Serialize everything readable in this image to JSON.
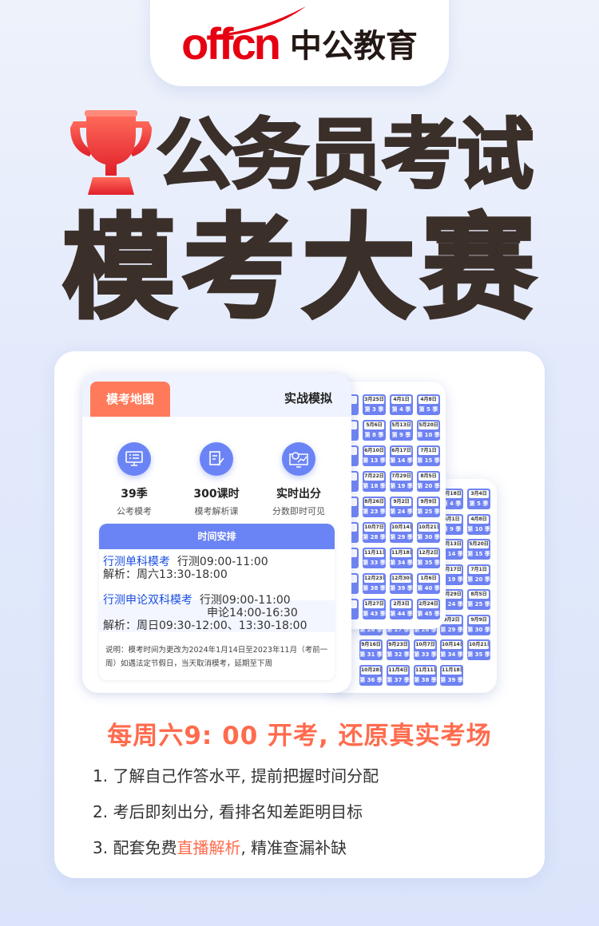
{
  "logo": {
    "en": "offcn",
    "cn": "中公教育"
  },
  "title": {
    "line1": "公务员考试",
    "line2": "模考大赛",
    "icon": "trophy-icon"
  },
  "map_card": {
    "tab": "模考地图",
    "right": "实战模拟",
    "features": [
      {
        "icon": "monitor-checklist-icon",
        "title": "39季",
        "subtitle": "公考模考"
      },
      {
        "icon": "document-pen-icon",
        "title": "300课时",
        "subtitle": "模考解析课"
      },
      {
        "icon": "live-score-icon",
        "title": "实时出分",
        "subtitle": "分数即时可见"
      }
    ],
    "schedule": {
      "header": "时间安排",
      "single": {
        "name": "行测单科模考",
        "time": "行测09:00-11:00",
        "analysis": "解析：周六13:30-18:00"
      },
      "double": {
        "name": "行测申论双科模考",
        "time1": "行测09:00-11:00",
        "time2": "申论14:00-16:30",
        "analysis": "解析：周日09:30-12:00、13:30-18:00"
      },
      "note": "说明：模考时间为更改为2024年1月14日至2023年11月（考前一周）如遇法定节假日，当天取消模考，延期至下周"
    }
  },
  "calendar_front": [
    [
      {
        "date": "3月25日",
        "season": "第 3 季"
      },
      {
        "date": "4月1日",
        "season": "第 4 季"
      },
      {
        "date": "4月8日",
        "season": "第 5 季"
      }
    ],
    [
      {
        "date": "5月6日",
        "season": "第 8 季"
      },
      {
        "date": "5月13日",
        "season": "第 9 季"
      },
      {
        "date": "5月20日",
        "season": "第 10 季"
      }
    ],
    [
      {
        "date": "6月10日",
        "season": "第 13 季"
      },
      {
        "date": "6月17日",
        "season": "第 14 季"
      },
      {
        "date": "7月1日",
        "season": "第 15 季"
      }
    ],
    [
      {
        "date": "7月22日",
        "season": "第 18 季"
      },
      {
        "date": "7月29日",
        "season": "第 19 季"
      },
      {
        "date": "8月5日",
        "season": "第 20 季"
      }
    ],
    [
      {
        "date": "8月26日",
        "season": "第 23 季"
      },
      {
        "date": "9月2日",
        "season": "第 24 季"
      },
      {
        "date": "9月9日",
        "season": "第 25 季"
      }
    ],
    [
      {
        "date": "10月7日",
        "season": "第 28 季"
      },
      {
        "date": "10月14日",
        "season": "第 29 季"
      },
      {
        "date": "10月21日",
        "season": "第 30 季"
      }
    ],
    [
      {
        "date": "11月11日",
        "season": "第 33 季"
      },
      {
        "date": "11月18日",
        "season": "第 34 季"
      },
      {
        "date": "12月2日",
        "season": "第 35 季"
      }
    ],
    [
      {
        "date": "12月23日",
        "season": "第 38 季"
      },
      {
        "date": "12月30日",
        "season": "第 39 季"
      },
      {
        "date": "1月6日",
        "season": "第 40 季"
      }
    ],
    [
      {
        "date": "1月27日",
        "season": "第 43 季"
      },
      {
        "date": "2月3日",
        "season": "第 44 季"
      },
      {
        "date": "2月24日",
        "season": "第 45 季"
      }
    ]
  ],
  "calendar_back": [
    [
      null,
      null,
      null,
      {
        "date": "2月18日",
        "season": "第 4 季"
      },
      {
        "date": "3月4日",
        "season": "第 5 季"
      }
    ],
    [
      null,
      null,
      null,
      {
        "date": "4月1日",
        "season": "第 9 季"
      },
      {
        "date": "4月8日",
        "season": "第 10 季"
      }
    ],
    [
      null,
      null,
      null,
      {
        "date": "5月13日",
        "season": "第 14 季"
      },
      {
        "date": "5月20日",
        "season": "第 15 季"
      }
    ],
    [
      null,
      null,
      null,
      {
        "date": "6月17日",
        "season": "第 19 季"
      },
      {
        "date": "7月1日",
        "season": "第 20 季"
      }
    ],
    [
      null,
      null,
      null,
      {
        "date": "7月29日",
        "season": "第 24 季"
      },
      {
        "date": "8月5日",
        "season": "第 25 季"
      }
    ],
    [
      {
        "date": "",
        "season": "第 26 季"
      },
      {
        "date": "",
        "season": "第 27 季"
      },
      {
        "date": "",
        "season": "第 28 季"
      },
      {
        "date": "9月2日",
        "season": "第 29 季"
      },
      {
        "date": "9月9日",
        "season": "第 30 季"
      }
    ],
    [
      {
        "date": "9月16日",
        "season": "第 31 季"
      },
      {
        "date": "9月23日",
        "season": "第 32 季"
      },
      {
        "date": "10月7日",
        "season": "第 33 季"
      },
      {
        "date": "10月14日",
        "season": "第 34 季"
      },
      {
        "date": "10月21日",
        "season": "第 35 季"
      }
    ],
    [
      {
        "date": "10月28日",
        "season": "第 36 季"
      },
      {
        "date": "11月4日",
        "season": "第 37 季"
      },
      {
        "date": "11月11日",
        "season": "第 38 季"
      },
      {
        "date": "11月18日",
        "season": "第 39 季"
      }
    ]
  ],
  "headline": "每周六9: 00 开考, 还原真实考场",
  "benefits": [
    {
      "text": "1. 了解自己作答水平, 提前把握时间分配"
    },
    {
      "text": "2. 考后即刻出分, 看排名知差距明目标"
    },
    {
      "pre": "3. 配套免费",
      "highlight": "直播解析",
      "post": ", 精准查漏补缺"
    }
  ],
  "colors": {
    "accent": "#ff6b4d",
    "brand_red": "#e60012",
    "blue": "#6b84f5",
    "title": "#3b2f2a"
  }
}
